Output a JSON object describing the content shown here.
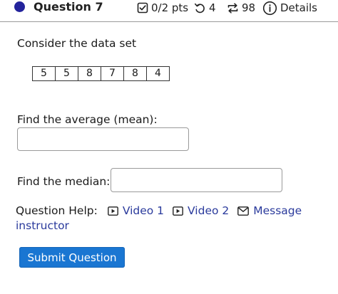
{
  "question": {
    "title": "Question 7",
    "points": "0/2 pts",
    "retries": "4",
    "attempts": "98",
    "details": "Details"
  },
  "prompt": "Consider the data set",
  "dataset": [
    "5",
    "5",
    "8",
    "7",
    "8",
    "4"
  ],
  "mean_label": "Find the average (mean):",
  "mean_value": "",
  "median_label": "Find the median:",
  "median_value": "",
  "help": {
    "label": "Question Help:",
    "video1": "Video 1",
    "video2": "Video 2",
    "message": "Message",
    "message_cont": "instructor"
  },
  "submit_label": "Submit Question",
  "icons": {
    "status": "status-dot-icon",
    "points": "checkbox-icon",
    "retry": "retry-icon",
    "attempts": "attempts-cycle-icon",
    "details": "info-icon",
    "video": "video-play-icon",
    "message": "envelope-icon"
  },
  "colors": {
    "status_dot": "#23239c",
    "link": "#2a3a9c",
    "button": "#1a76d2"
  }
}
